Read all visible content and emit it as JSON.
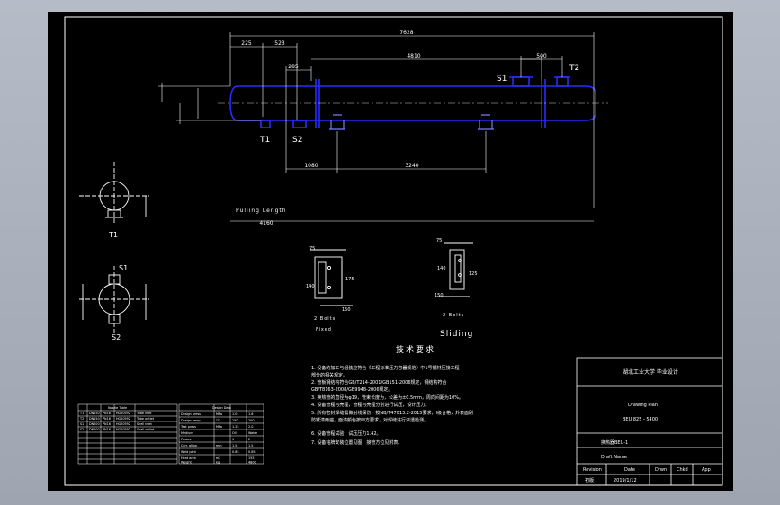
{
  "drawing": {
    "overall_length": "7628",
    "dim_225": "225",
    "dim_523": "523",
    "dim_285": "285",
    "dim_4810": "4810",
    "dim_500": "500",
    "dim_1080": "1080",
    "dim_3240": "3240",
    "dim_4160": "4160",
    "pulling_length_label": "Pulling Length",
    "nozzle_labels": {
      "T1": "T1",
      "T2": "T2",
      "S1": "S1",
      "S2": "S2"
    },
    "side_view_labels": {
      "t1": "T1",
      "s1": "S1",
      "s2": "S2"
    },
    "saddle_fixed": {
      "dim_top": "75",
      "dim_side": "140",
      "dim_inner": "175",
      "dim_bottom": "150",
      "bolt_label": "2 Bolts",
      "caption": "Fixed"
    },
    "saddle_sliding": {
      "dim_top": "75",
      "dim_side": "140",
      "dim_inner": "125",
      "dim_bottom": "150",
      "bolt_label": "2 Bolts",
      "caption": "Sliding"
    }
  },
  "notes": {
    "heading": "技术要求",
    "lines": [
      "1. 设备的加工与组装应符合《工程标准压力容器规范》中1号钢材压接工程",
      "   部分的相关规定。",
      "2. 管板钢结构符合GB/T214-2001/GB151-2006规定，钢结构符合",
      "   GB/T8163-2008/GB9948-2006规定。",
      "3. 换热管的直径为φ19，管束长度为，公差为±0.5mm，周向间距为10%。",
      "4. 设备管程与壳程，管程与壳程分别进行试压，设计压力。",
      "5. 所有密封焊缝需做射线探伤，按NB/T47013.2-2015要求，I级合格，外表面刷",
      "   防锈漆两遍，面漆颜色按甲方要求，对焊缝进行渗透检测。",
      "6. 设备管程试验，试压压力1.42。",
      "7. 设备铭牌安装位置见图，接管方位见附表。"
    ]
  },
  "title_block": {
    "company": "湖北工业大学 毕业设计",
    "drawing_name": "Drawing Plan",
    "model": "BEU 825 - 5400",
    "drawing_no": "换热器BEU-1",
    "drafter": "Draft Name",
    "col_headers": [
      "Revision",
      "Date",
      "Drwn",
      "Chkd",
      "App"
    ],
    "row": [
      "初版",
      "2019/1/12",
      "",
      "",
      ""
    ]
  },
  "nozzle_table": {
    "header": "Nozzle Table",
    "rows": [
      [
        "T1",
        "DN150",
        "PN16",
        "HG20592",
        "Tube inlet"
      ],
      [
        "T2",
        "DN150",
        "PN16",
        "HG20592",
        "Tube outlet"
      ],
      [
        "S1",
        "DN200",
        "PN16",
        "HG20592",
        "Shell inlet"
      ],
      [
        "S2",
        "DN200",
        "PN16",
        "HG20592",
        "Shell outlet"
      ]
    ]
  },
  "design_table": {
    "header": "Design Data",
    "rows": [
      [
        "Design press",
        "MPa",
        "1.0",
        "1.6"
      ],
      [
        "Design temp",
        "°C",
        "150",
        "200"
      ],
      [
        "Test press",
        "MPa",
        "1.25",
        "2.0"
      ],
      [
        "Medium",
        "",
        "Oil",
        "Water"
      ],
      [
        "Passes",
        "",
        "1",
        "2"
      ],
      [
        "Corr. allow.",
        "mm",
        "1.5",
        "1.5"
      ],
      [
        "Weld joint",
        "",
        "0.85",
        "0.85"
      ],
      [
        "Heat area",
        "m2",
        "",
        "155"
      ],
      [
        "Weight",
        "kg",
        "",
        "4800"
      ]
    ],
    "footer": [
      "Date",
      "Sheet",
      "Scale"
    ]
  },
  "colors": {
    "sheet": "#000000",
    "frame": "#ffffff",
    "vessel": "#2a2aff",
    "saddle": "#7878ff",
    "text": "#ffffff"
  }
}
